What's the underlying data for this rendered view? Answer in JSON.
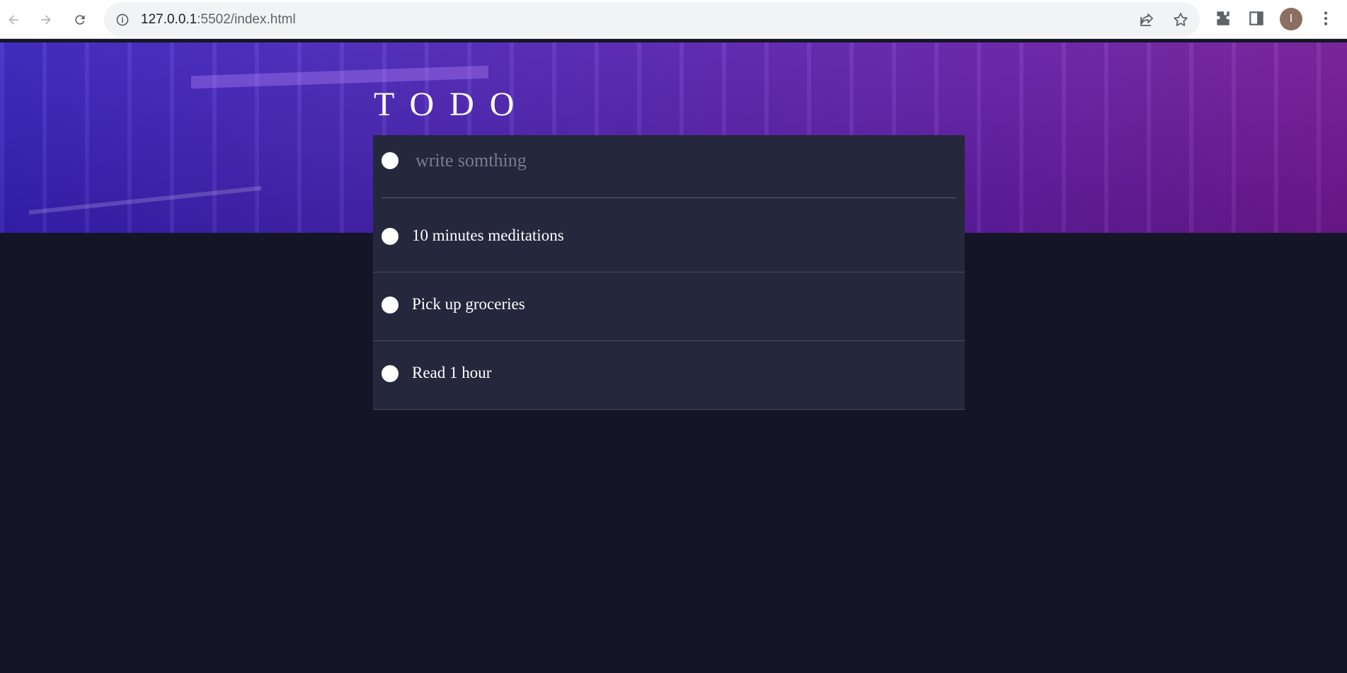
{
  "browser": {
    "url_host": "127.0.0.1",
    "url_rest": ":5502/index.html",
    "avatar_initial": "I",
    "icons": [
      "back-arrow-icon",
      "forward-arrow-icon",
      "reload-icon",
      "info-icon",
      "share-icon",
      "star-icon",
      "extensions-icon",
      "side-panel-icon",
      "menu-dots-icon"
    ]
  },
  "app": {
    "title": "TODO",
    "input_placeholder": "write somthing",
    "todos": [
      {
        "text": "10 minutes meditations"
      },
      {
        "text": "Pick up groceries"
      },
      {
        "text": "Read 1 hour"
      }
    ]
  },
  "colors": {
    "page_bg": "#141628",
    "panel_bg": "#25273c",
    "hero_start": "#3a22c4",
    "hero_end": "#7a1a9e"
  }
}
